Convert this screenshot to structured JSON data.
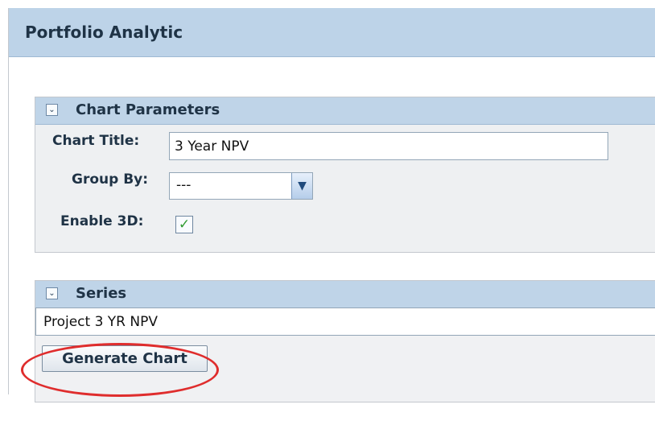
{
  "panel": {
    "title": "Portfolio Analytic"
  },
  "parameters": {
    "title": "Chart Parameters",
    "chart_title_label": "Chart Title:",
    "chart_title_value": "3 Year NPV",
    "group_by_label": "Group By:",
    "group_by_value": "---",
    "enable_3d_label": "Enable 3D:",
    "enable_3d_checked": true
  },
  "series": {
    "title": "Series",
    "items": [
      "Project 3 YR NPV"
    ]
  },
  "actions": {
    "generate_label": "Generate Chart"
  },
  "colors": {
    "header": "#bdd3e8",
    "section_header": "#bfd4e8",
    "text": "#1f3346",
    "highlight": "#df2d2d",
    "checkmark": "#2f9b32"
  }
}
